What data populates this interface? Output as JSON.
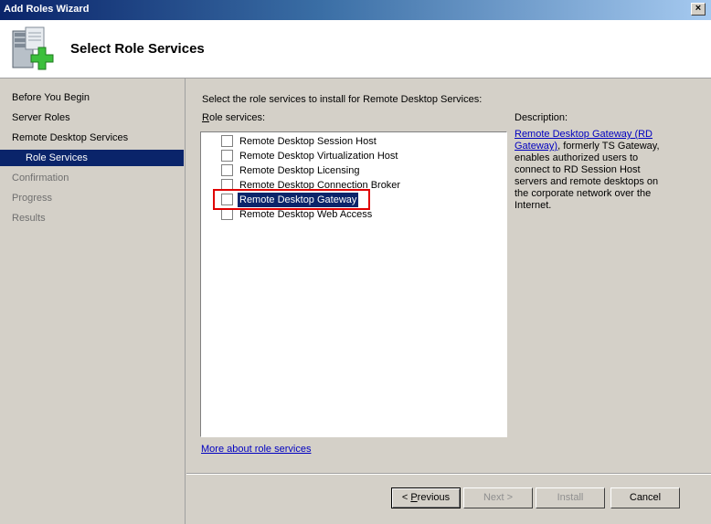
{
  "window": {
    "title": "Add Roles Wizard",
    "close_glyph": "×"
  },
  "header": {
    "heading": "Select Role Services",
    "icon": "server-add-icon"
  },
  "nav": {
    "items": [
      {
        "label": "Before You Begin",
        "state": "normal"
      },
      {
        "label": "Server Roles",
        "state": "normal"
      },
      {
        "label": "Remote Desktop Services",
        "state": "normal"
      },
      {
        "label": "Role Services",
        "state": "selected"
      },
      {
        "label": "Confirmation",
        "state": "disabled"
      },
      {
        "label": "Progress",
        "state": "disabled"
      },
      {
        "label": "Results",
        "state": "disabled"
      }
    ]
  },
  "main": {
    "instruction": "Select the role services to install for Remote Desktop Services:",
    "services_label_first": "R",
    "services_label_rest": "ole services:",
    "services": [
      {
        "label": "Remote Desktop Session Host",
        "checked": false
      },
      {
        "label": "Remote Desktop Virtualization Host",
        "checked": false
      },
      {
        "label": "Remote Desktop Licensing",
        "checked": false
      },
      {
        "label": "Remote Desktop Connection Broker",
        "checked": false
      },
      {
        "label": "Remote Desktop Gateway",
        "checked": false,
        "selected": true
      },
      {
        "label": "Remote Desktop Web Access",
        "checked": false
      }
    ],
    "description_label": "Description:",
    "description_link": "Remote Desktop Gateway (RD Gateway)",
    "description_text": ", formerly TS Gateway, enables authorized users to connect to RD Session Host servers and remote desktops on the corporate network over the Internet.",
    "more_link": "More about role services"
  },
  "buttons": {
    "previous_prefix": "< ",
    "previous_underline": "P",
    "previous_rest": "revious",
    "next": "Next >",
    "install": "Install",
    "cancel": "Cancel"
  },
  "colors": {
    "selection": "#0a246a",
    "highlight_box": "#e00000",
    "link": "#0000c0"
  }
}
